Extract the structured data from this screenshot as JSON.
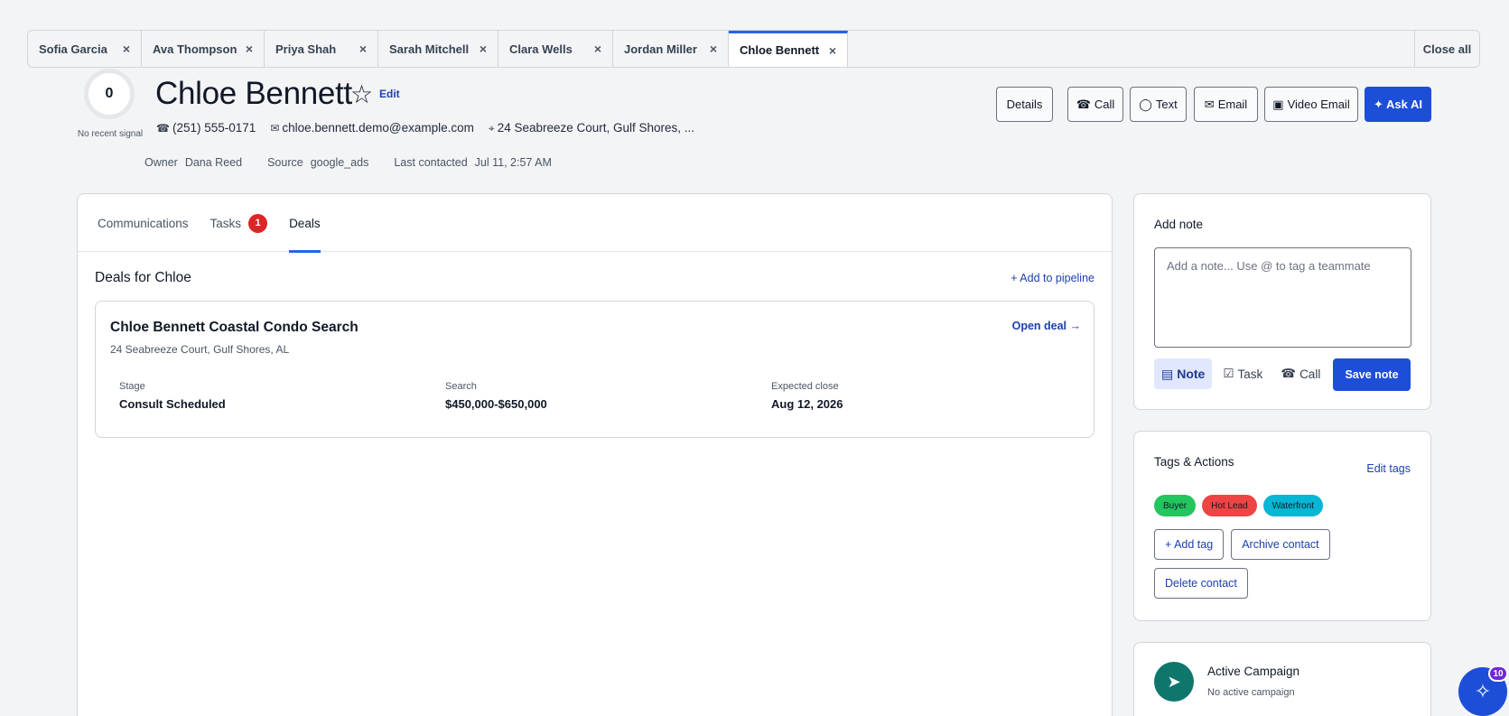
{
  "tabs": [
    {
      "label": "Sofia Garcia",
      "width": 126
    },
    {
      "label": "Ava Thompson",
      "width": 136
    },
    {
      "label": "Priya Shah",
      "width": 126
    },
    {
      "label": "Sarah Mitchell",
      "width": 133
    },
    {
      "label": "Clara Wells",
      "width": 127
    },
    {
      "label": "Jordan Miller",
      "width": 128
    },
    {
      "label": "Chloe Bennett",
      "width": 132
    }
  ],
  "close_tab_glyph": "×",
  "close_all_label": "Close all",
  "contact": {
    "signal_score": "0",
    "signal_label": "No recent signal",
    "name": "Chloe Bennett",
    "star_glyph": "☆",
    "edit_label": "Edit",
    "phone": "(251) 555-0171",
    "email": "chloe.bennett.demo@example.com",
    "address_short": "24 Seabreeze Court, Gulf Shores, ...",
    "owner_label": "Owner",
    "owner": "Dana Reed",
    "source_label": "Source",
    "source": "google_ads",
    "last_contacted_label": "Last contacted",
    "last_contacted": "Jul 11, 2:57 AM"
  },
  "header_actions": {
    "details": "Details",
    "call": "Call",
    "text": "Text",
    "email": "Email",
    "video_email": "Video Email",
    "ask_ai": "✦ Ask AI"
  },
  "main_tabs": {
    "communications": "Communications",
    "tasks": "Tasks",
    "tasks_count": "1",
    "deals": "Deals"
  },
  "deals": {
    "title": "Deals for Chloe",
    "add_pipeline": "+ Add to pipeline",
    "card": {
      "name": "Chloe Bennett Coastal Condo Search",
      "address": "24 Seabreeze Court, Gulf Shores, AL",
      "open_label": "Open deal →",
      "stage_label": "Stage",
      "stage": "Consult Scheduled",
      "search_label": "Search",
      "search": "$450,000-$650,000",
      "close_label": "Expected close",
      "close": "Aug 12, 2026"
    }
  },
  "note": {
    "title": "Add note",
    "placeholder": "Add a note... Use @ to tag a teammate",
    "type_note": "Note",
    "type_task": "Task",
    "type_call": "Call",
    "save": "Save note"
  },
  "tags_actions": {
    "title": "Tags & Actions",
    "edit_tags": "Edit tags",
    "tags": [
      {
        "label": "Buyer",
        "color": "#22c55e"
      },
      {
        "label": "Hot Lead",
        "color": "#ef4444"
      },
      {
        "label": "Waterfront",
        "color": "#06b6d4"
      }
    ],
    "add_tag": "+ Add tag",
    "archive": "Archive contact",
    "delete": "Delete contact"
  },
  "campaign": {
    "title": "Active Campaign",
    "subtitle": "No active campaign"
  },
  "fab": {
    "badge": "10"
  },
  "colors": {
    "accent": "#1d4ed8",
    "link": "#1e40af",
    "badge_red": "#dc2626",
    "campaign_teal": "#0f766e"
  }
}
